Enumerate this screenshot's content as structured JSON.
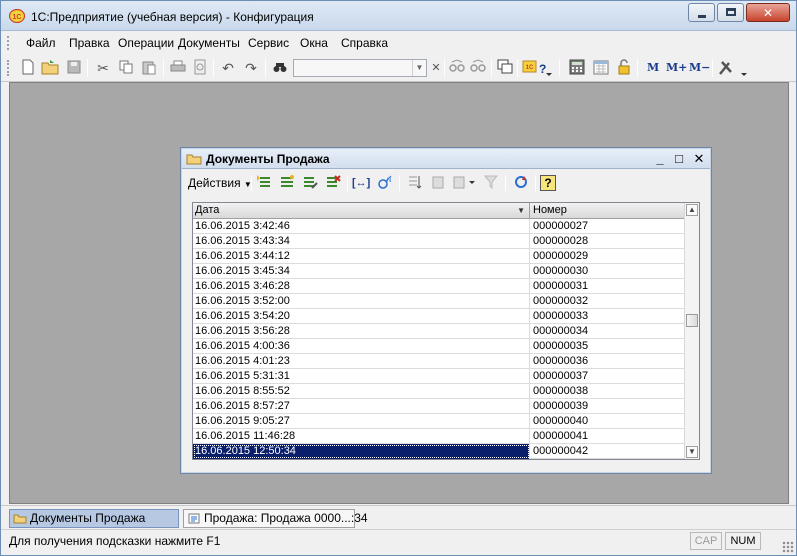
{
  "window": {
    "title": "1С:Предприятие (учебная версия) - Конфигурация",
    "min_glyph": "",
    "max_glyph": "",
    "close_glyph": "✕"
  },
  "menu": {
    "items": [
      "Файл",
      "Правка",
      "Операции",
      "Документы",
      "Сервис",
      "Окна",
      "Справка"
    ]
  },
  "toolbar": {
    "search_value": "",
    "text_buttons": [
      "M",
      "M+",
      "M−"
    ]
  },
  "child_window": {
    "title": "Документы Продажа",
    "min_glyph": "_",
    "max_glyph": "□",
    "close_glyph": "✕",
    "actions_label": "Действия",
    "help_glyph": "?"
  },
  "table": {
    "columns": [
      "Дата",
      "Номер"
    ],
    "rows": [
      [
        "16.06.2015 3:42:46",
        "000000027"
      ],
      [
        "16.06.2015 3:43:34",
        "000000028"
      ],
      [
        "16.06.2015 3:44:12",
        "000000029"
      ],
      [
        "16.06.2015 3:45:34",
        "000000030"
      ],
      [
        "16.06.2015 3:46:28",
        "000000031"
      ],
      [
        "16.06.2015 3:52:00",
        "000000032"
      ],
      [
        "16.06.2015 3:54:20",
        "000000033"
      ],
      [
        "16.06.2015 3:56:28",
        "000000034"
      ],
      [
        "16.06.2015 4:00:36",
        "000000035"
      ],
      [
        "16.06.2015 4:01:23",
        "000000036"
      ],
      [
        "16.06.2015 5:31:31",
        "000000037"
      ],
      [
        "16.06.2015 8:55:52",
        "000000038"
      ],
      [
        "16.06.2015 8:57:27",
        "000000039"
      ],
      [
        "16.06.2015 9:05:27",
        "000000040"
      ],
      [
        "16.06.2015 11:46:28",
        "000000041"
      ],
      [
        "16.06.2015 12:50:34",
        "000000042"
      ]
    ],
    "selected_row": 15
  },
  "window_tabs": [
    {
      "label": "Документы Продажа",
      "active": true
    },
    {
      "label": "Продажа: Продажа 0000...:34",
      "active": false
    }
  ],
  "status": {
    "hint": "Для получения подсказки нажмите F1",
    "cap": "CAP",
    "num": "NUM"
  },
  "colors": {
    "selection": "#0a1f6b",
    "workspace": "#a7a7a7"
  }
}
